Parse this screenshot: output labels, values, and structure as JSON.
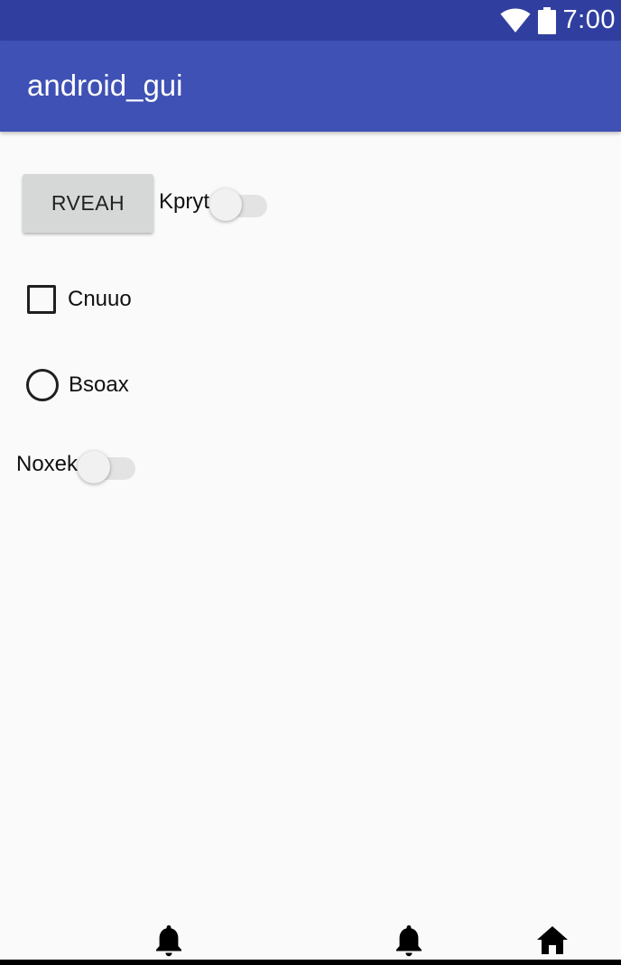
{
  "status_bar": {
    "time": "7:00",
    "icons": [
      "wifi-icon",
      "battery-icon"
    ]
  },
  "app_bar": {
    "title": "android_gui"
  },
  "content": {
    "button_label": "RVEAH",
    "switch1": {
      "label": "Kpryt",
      "checked": false
    },
    "checkbox": {
      "label": "Cnuuo",
      "checked": false
    },
    "radio": {
      "label": "Bsoax",
      "checked": false
    },
    "switch2": {
      "label": "Noxek",
      "checked": false
    }
  },
  "bottom_icons": [
    "bell-icon",
    "bell-icon",
    "home-icon"
  ],
  "colors": {
    "status_bar": "#303f9f",
    "app_bar": "#3f51b5",
    "background": "#fafafa"
  }
}
